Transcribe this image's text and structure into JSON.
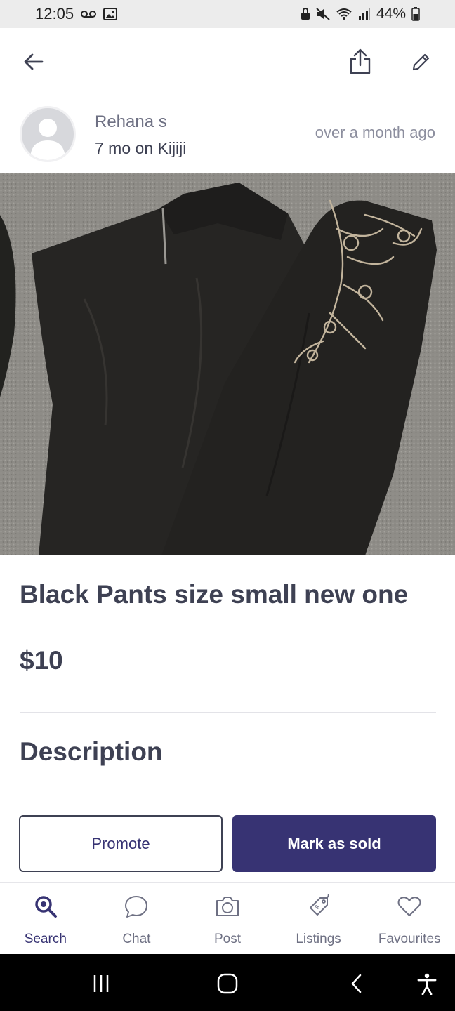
{
  "status_bar": {
    "time": "12:05",
    "battery": "44%"
  },
  "seller": {
    "name": "Rehana s",
    "tenure": "7 mo on Kijiji",
    "posted": "over a month  ago"
  },
  "listing": {
    "title": "Black Pants size small new one",
    "price": "$10",
    "description_heading": "Description"
  },
  "actions": {
    "promote_label": "Promote",
    "mark_sold_label": "Mark as sold"
  },
  "bottom_nav": {
    "items": [
      {
        "label": "Search",
        "icon": "search-icon",
        "active": true
      },
      {
        "label": "Chat",
        "icon": "chat-icon",
        "active": false
      },
      {
        "label": "Post",
        "icon": "camera-icon",
        "active": false
      },
      {
        "label": "Listings",
        "icon": "price-tag-icon",
        "active": false
      },
      {
        "label": "Favourites",
        "icon": "heart-icon",
        "active": false
      }
    ]
  },
  "colors": {
    "brand_primary": "#373373",
    "text_dark": "#3e4153",
    "text_muted": "#6e7083"
  }
}
